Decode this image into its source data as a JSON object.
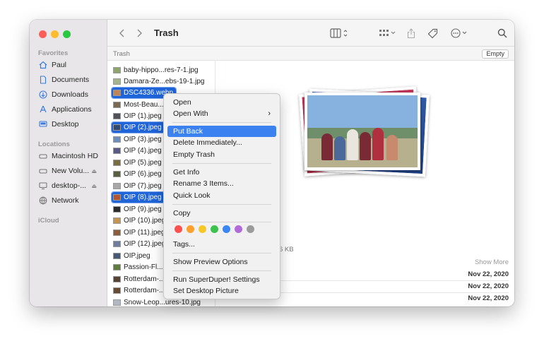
{
  "sidebar": {
    "favorites_header": "Favorites",
    "favorites": [
      {
        "label": "Paul",
        "icon": "home-icon"
      },
      {
        "label": "Documents",
        "icon": "document-icon"
      },
      {
        "label": "Downloads",
        "icon": "download-icon"
      },
      {
        "label": "Applications",
        "icon": "applications-icon"
      },
      {
        "label": "Desktop",
        "icon": "desktop-icon"
      }
    ],
    "locations_header": "Locations",
    "locations": [
      {
        "label": "Macintosh HD",
        "icon": "disk-icon",
        "eject": false
      },
      {
        "label": "New Volu...",
        "icon": "disk-icon",
        "eject": true
      },
      {
        "label": "desktop-...",
        "icon": "monitor-icon",
        "eject": true
      },
      {
        "label": "Network",
        "icon": "network-icon",
        "eject": false
      }
    ],
    "icloud_header": "iCloud"
  },
  "toolbar": {
    "title": "Trash",
    "back_icon": "chevron-left-icon",
    "forward_icon": "chevron-right-icon"
  },
  "pathbar": {
    "label": "Trash",
    "empty_button": "Empty"
  },
  "files": [
    {
      "name": "baby-hippo...res-7-1.jpg",
      "selected": false
    },
    {
      "name": "Damara-Ze...ebs-19-1.jpg",
      "selected": false
    },
    {
      "name": "DSC4336.webp",
      "selected": true
    },
    {
      "name": "Most-Beau...",
      "selected": false
    },
    {
      "name": "OIP (1).jpeg",
      "selected": false
    },
    {
      "name": "OIP (2).jpeg",
      "selected": true
    },
    {
      "name": "OIP (3).jpeg",
      "selected": false
    },
    {
      "name": "OIP (4).jpeg",
      "selected": false
    },
    {
      "name": "OIP (5).jpeg",
      "selected": false
    },
    {
      "name": "OIP (6).jpeg",
      "selected": false
    },
    {
      "name": "OIP (7).jpeg",
      "selected": false
    },
    {
      "name": "OIP (8).jpeg",
      "selected": true
    },
    {
      "name": "OIP (9).jpeg",
      "selected": false
    },
    {
      "name": "OIP (10).jpeg",
      "selected": false
    },
    {
      "name": "OIP (11).jpeg",
      "selected": false
    },
    {
      "name": "OIP (12).jpeg",
      "selected": false
    },
    {
      "name": "OIP.jpeg",
      "selected": false
    },
    {
      "name": "Passion-Fl...",
      "selected": false
    },
    {
      "name": "Rotterdam-...",
      "selected": false
    },
    {
      "name": "Rotterdam-...",
      "selected": false
    },
    {
      "name": "Snow-Leop...ures-10.jpg",
      "selected": false
    }
  ],
  "preview": {
    "size_fragment": "6 KB",
    "show_more": "Show More",
    "dates": [
      "Nov 22, 2020",
      "Nov 22, 2020",
      "Nov 22, 2020"
    ]
  },
  "context_menu": {
    "open": "Open",
    "open_with": "Open With",
    "put_back": "Put Back",
    "delete_immediately": "Delete Immediately...",
    "empty_trash": "Empty Trash",
    "get_info": "Get Info",
    "rename": "Rename 3 Items...",
    "quick_look": "Quick Look",
    "copy": "Copy",
    "tags": "Tags...",
    "show_preview_options": "Show Preview Options",
    "run_superduper": "Run SuperDuper! Settings",
    "set_desktop_picture": "Set Desktop Picture",
    "tag_colors": [
      "#ff4f4f",
      "#ff9f2e",
      "#f5c825",
      "#3ec24f",
      "#3a86f5",
      "#b26ad9",
      "#9b9b9b"
    ]
  },
  "colors": {
    "selection": "#1f64d8",
    "menu_highlight": "#3b82f0"
  }
}
